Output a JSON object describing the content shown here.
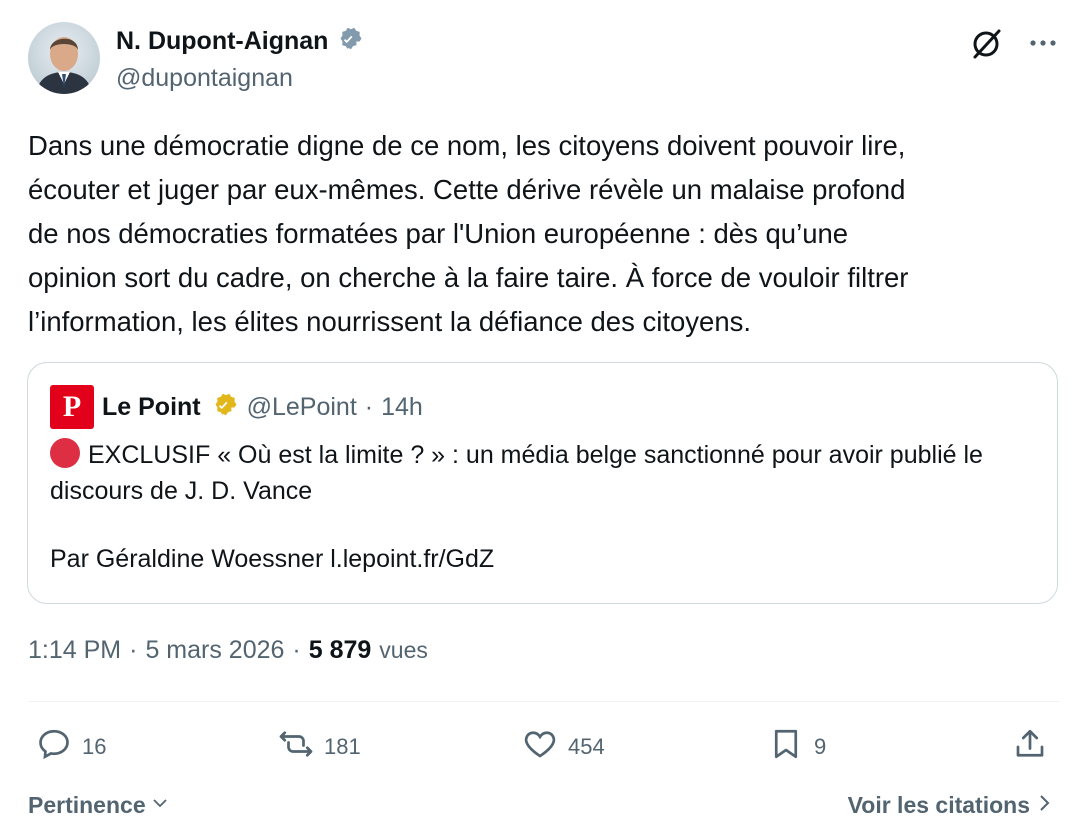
{
  "author": {
    "display_name": "N. Dupont-Aignan",
    "handle": "@dupontaignan",
    "verified_color": "#829aab"
  },
  "tweet": {
    "text": "Dans une démocratie digne de ce nom, les citoyens doivent pouvoir lire,\nécouter et juger par eux-mêmes. Cette dérive révèle un malaise profond\nde nos démocraties formatées par l'Union européenne : dès qu’une\nopinion sort du cadre, on cherche à la faire taire. À force de vouloir filtrer\nl’information, les élites nourrissent la défiance des citoyens."
  },
  "quote": {
    "logo_letter": "P",
    "name": "Le Point",
    "handle": "@LePoint",
    "separator": "·",
    "time": "14h",
    "badge_color": "#e2b719",
    "headline": "EXCLUSIF « Où est la limite ? » : un média belge sanctionné pour avoir publié le discours de J. D. Vance",
    "author_line": "Par Géraldine Woessner l.lepoint.fr/GdZ"
  },
  "meta": {
    "time": "1:14 PM",
    "sep1": "·",
    "date": "5 mars 2026",
    "sep2": "·",
    "views": "5 879",
    "views_label": "vues"
  },
  "actions": {
    "replies": "16",
    "retweets": "181",
    "likes": "454",
    "bookmarks": "9"
  },
  "footer": {
    "sort_label": "Pertinence",
    "citations_label": "Voir les citations"
  },
  "icons": {
    "reply": "reply-icon",
    "retweet": "retweet-icon",
    "like": "heart-icon",
    "bookmark": "bookmark-icon",
    "share": "share-icon",
    "grok": "grok-icon",
    "more": "more-icon"
  }
}
